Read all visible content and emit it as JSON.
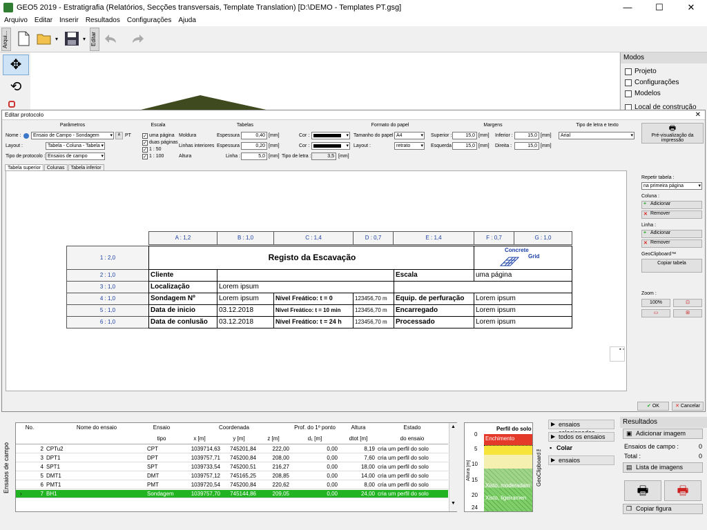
{
  "window": {
    "title": "GEO5 2019 - Estratigrafia (Relatórios, Secções transversais, Template Translation) [D:\\DEMO - Templates PT.gsg]",
    "min": "—",
    "max": "☐",
    "close": "✕"
  },
  "menu": [
    "Arquivo",
    "Editar",
    "Inserir",
    "Resultados",
    "Configurações",
    "Ajuda"
  ],
  "toolbar": {
    "left_tab": "Arqui...",
    "edit_tab": "Editar"
  },
  "modes": {
    "title": "Modos",
    "items": [
      "Projeto",
      "Configurações",
      "Modelos",
      "Local de construção"
    ]
  },
  "dialog": {
    "title": "Editar protocolo",
    "close": "✕",
    "parametros": {
      "title": "Parâmetros",
      "nome_label": "Nome :",
      "nome_value": "Ensaio de Campo - Sondagem",
      "lang": "PT",
      "layout_label": "Layout :",
      "layout_value": "Tabela - Coluna - Tabela",
      "tipo_label": "Tipo de protocolo :",
      "tipo_value": "Ensaios de campo"
    },
    "escala": {
      "title": "Escala",
      "opts": [
        "uma página",
        "duas páginas",
        "1 : 50",
        "1 : 100"
      ]
    },
    "tabelas": {
      "title": "Tabelas",
      "moldura": "Moldura",
      "linhas": "Linhas interiores",
      "altura": "Altura",
      "espessura": "Espessura :",
      "linha": "Linha :",
      "v1": "0,40",
      "v2": "0,20",
      "v3": "5,0",
      "unit": "[mm]",
      "cor": "Cor :",
      "tipo_letra": "Tipo de letra :",
      "tipo_letra_v": "3,5"
    },
    "formato": {
      "title": "Formato do papel",
      "tamanho_label": "Tamanho do papel :",
      "tamanho_value": "A4",
      "layout_label": "Layout :",
      "layout_value": "retrato"
    },
    "margens": {
      "title": "Margens",
      "superior": "Superior :",
      "inferior": "Inferior :",
      "esquerda": "Esquerda :",
      "direita": "Direita :",
      "v": "15,0",
      "unit": "[mm]"
    },
    "fonte": {
      "title": "Tipo de letra e texto",
      "value": "Arial"
    },
    "preview_button": "Pré-visualização da impressão",
    "tabs": [
      "Tabela superior",
      "Colunas",
      "Tabela inferior"
    ],
    "right": {
      "repetir": "Repetir tabela :",
      "repetir_v": "na primeira página",
      "coluna": "Coluna :",
      "linha": "Linha :",
      "adicionar": "Adicionar",
      "remover": "Remover",
      "clip": "GeoClipboard™",
      "copiar": "Copiar tabela",
      "zoom": "Zoom :",
      "zoom_v": "100%"
    },
    "ok": "OK",
    "cancel": "Cancelar"
  },
  "protocol": {
    "cols": [
      "A : 1,2",
      "B : 1,0",
      "C : 1,4",
      "D : 0,7",
      "E : 1,4",
      "F : 0,7",
      "G : 1,0"
    ],
    "rows": [
      "1 : 2,0",
      "2 : 1,0",
      "3 : 1,0",
      "4 : 1,0",
      "5 : 1,0",
      "6 : 1,0"
    ],
    "title": "Registo da Escavação",
    "logo_l1": "Concrete",
    "logo_l2": "Grid",
    "r2": [
      "Cliente",
      "Escala",
      "uma página"
    ],
    "r3": [
      "Localização",
      "Lorem ipsum"
    ],
    "r4": [
      "Sondagem Nº",
      "Lorem ipsum",
      "Nível Freático: t = 0",
      "123456,70 m",
      "Equip. de perfuração",
      "Lorem ipsum"
    ],
    "r5": [
      "Data de inicio",
      "03.12.2018",
      "Nível Freático: t = 10 min",
      "123456,70 m",
      "Encarregado",
      "Lorem ipsum"
    ],
    "r6": [
      "Data de conlusão",
      "03.12.2018",
      "Nível Freático: t = 24 h",
      "123456,70 m",
      "Processado",
      "Lorem ipsum"
    ]
  },
  "grid": {
    "side_label": "Ensaios de campo",
    "headers": {
      "no": "No.",
      "nome": "Nome do ensaio",
      "ensaio": "Ensaio",
      "tipo": "tipo",
      "coord": "Coordenada",
      "x": "x [m]",
      "y": "y [m]",
      "z": "z [m]",
      "prof": "Prof. do 1º ponto",
      "d1": "d₁ [m]",
      "alt": "Altura",
      "dtot": "dtot [m]",
      "estado": "Estado",
      "do_ensaio": "do ensaio"
    },
    "rows": [
      {
        "no": "2",
        "nome": "CPTu2",
        "tipo": "CPT",
        "x": "1039714,63",
        "y": "745201,84",
        "z": "222,00",
        "d1": "0,00",
        "d": "8,19",
        "estado": "cria um perfil do solo"
      },
      {
        "no": "3",
        "nome": "DPT1",
        "tipo": "DPT",
        "x": "1039757,71",
        "y": "745200,84",
        "z": "208,00",
        "d1": "0,00",
        "d": "7,60",
        "estado": "cria um perfil do solo"
      },
      {
        "no": "4",
        "nome": "SPT1",
        "tipo": "SPT",
        "x": "1039733,54",
        "y": "745200,51",
        "z": "216,27",
        "d1": "0,00",
        "d": "18,00",
        "estado": "cria um perfil do solo"
      },
      {
        "no": "5",
        "nome": "DMT1",
        "tipo": "DMT",
        "x": "1039757,12",
        "y": "745165,25",
        "z": "208,85",
        "d1": "0,00",
        "d": "14,00",
        "estado": "cria um perfil do solo"
      },
      {
        "no": "6",
        "nome": "PMT1",
        "tipo": "PMT",
        "x": "1039720,54",
        "y": "745200,84",
        "z": "220,62",
        "d1": "0,00",
        "d": "8,00",
        "estado": "cria um perfil do solo"
      },
      {
        "no": "7",
        "nome": "BH1",
        "tipo": "Sondagem",
        "x": "1039757,70",
        "y": "745144,86",
        "z": "209,05",
        "d1": "0,00",
        "d": "24,00",
        "estado": "cria um perfil do solo"
      }
    ]
  },
  "profile": {
    "title": "Perfil do solo",
    "axis": "Altura [m]",
    "ticks": [
      "0",
      "5",
      "10",
      "15",
      "20",
      "24"
    ],
    "l1": "Enchimento",
    "l2": "Xisto, moderadam",
    "l3": "Xisto, ligeiramen"
  },
  "geoclip": {
    "label": "GeoClipboard™",
    "b1": "ensaios selecionados",
    "b2": "todos os ensaios",
    "b3": "Colar",
    "b4": "ensaios"
  },
  "results": {
    "title": "Resultados",
    "add": "Adicionar imagem",
    "campo": "Ensaios de campo :",
    "campo_v": "0",
    "total": "Total :",
    "total_v": "0",
    "lista": "Lista de imagens",
    "copiar": "Copiar figura"
  }
}
